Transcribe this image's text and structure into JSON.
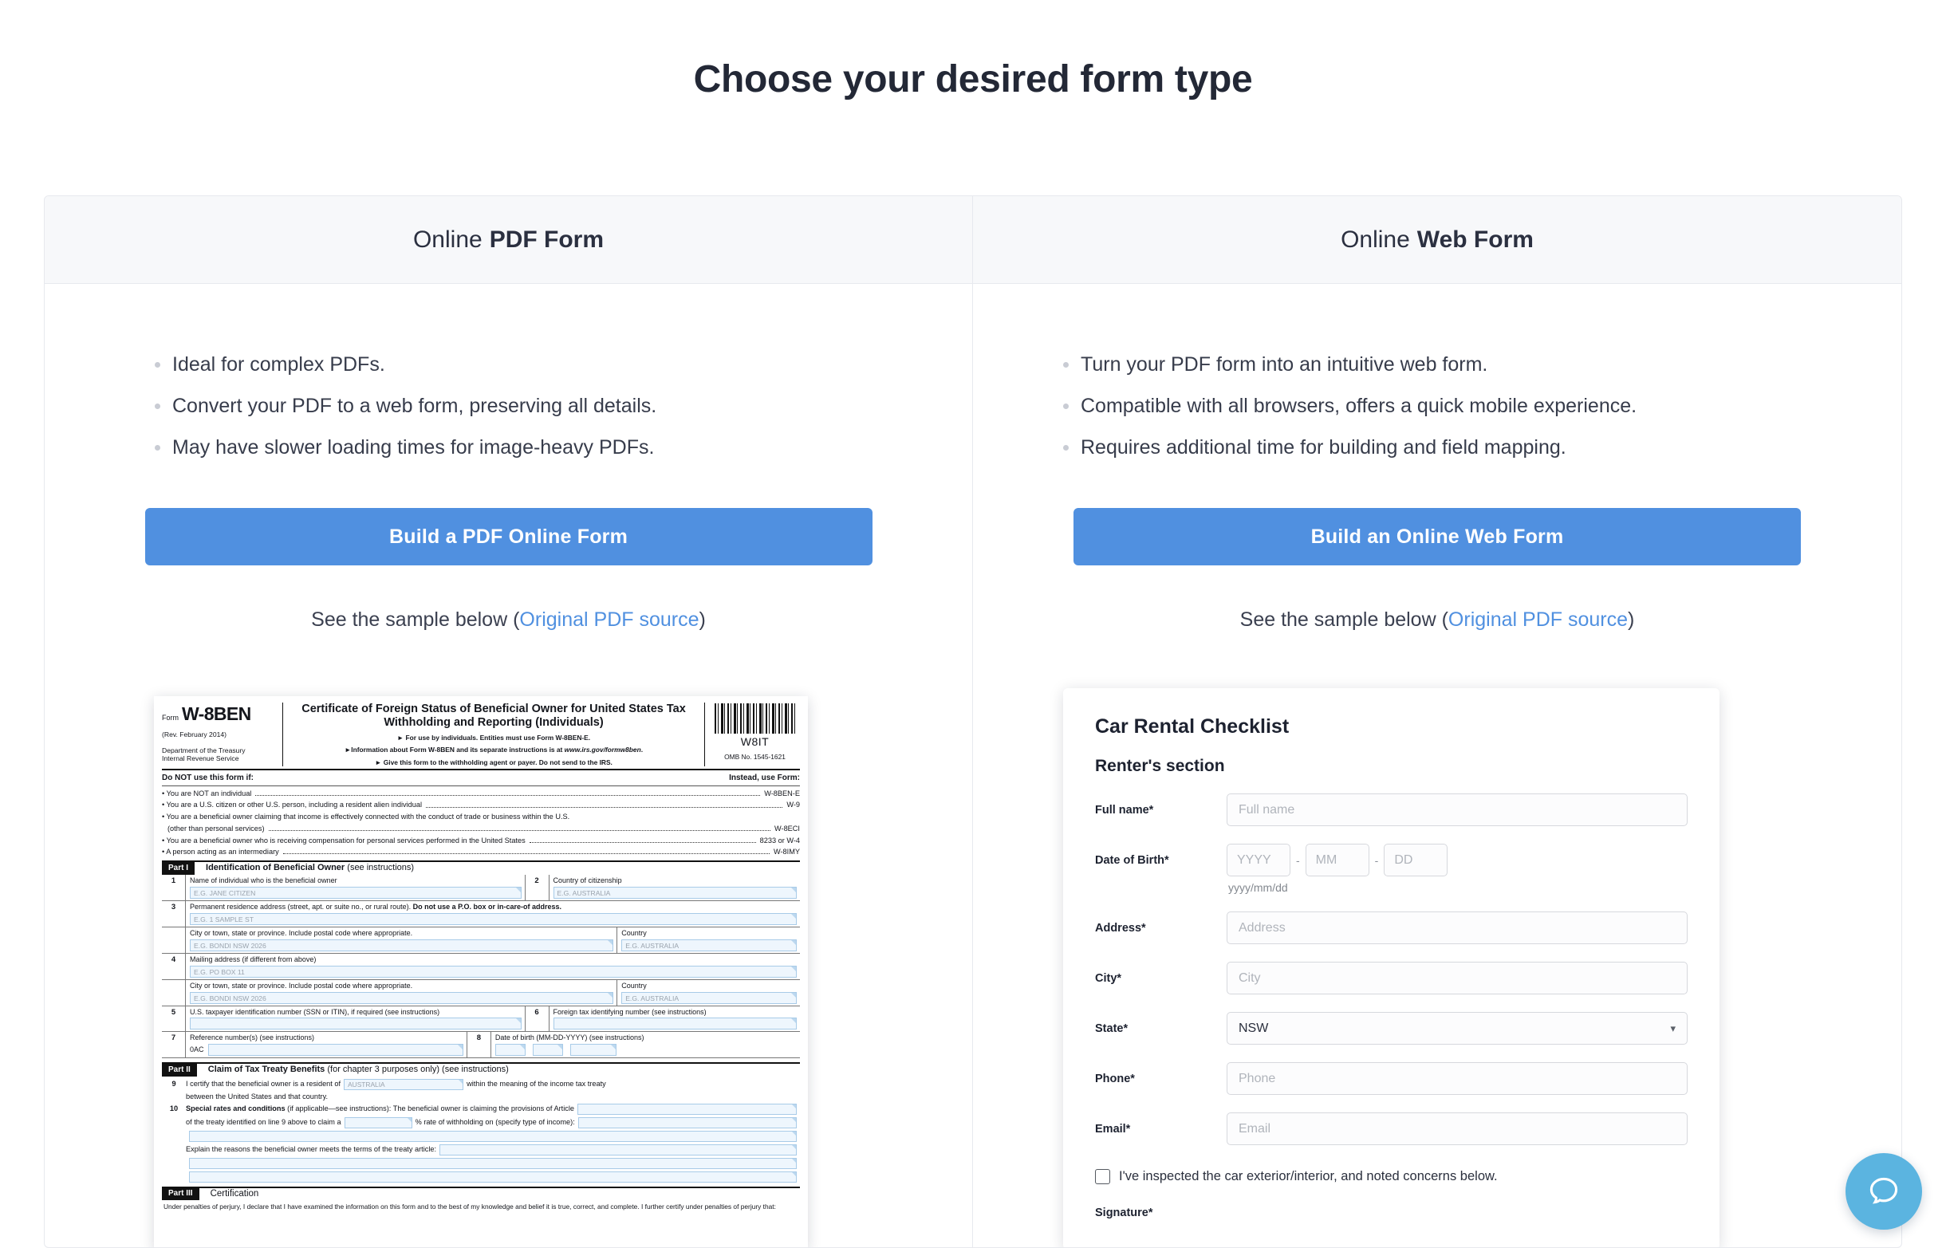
{
  "page": {
    "title": "Choose your desired form type"
  },
  "columns": [
    {
      "head_thin": "Online",
      "head_bold": "PDF Form",
      "bullets": [
        "Ideal for complex PDFs.",
        "Convert your PDF to a web form, preserving all details.",
        "May have slower loading times for image-heavy PDFs."
      ],
      "cta": "Build a PDF Online Form",
      "sample_prefix": "See the sample below (",
      "sample_link": "Original PDF source",
      "sample_suffix": ")"
    },
    {
      "head_thin": "Online",
      "head_bold": "Web Form",
      "bullets": [
        "Turn your PDF form into an intuitive web form.",
        "Compatible with all browsers, offers a quick mobile experience.",
        "Requires additional time for building and field mapping."
      ],
      "cta": "Build an Online Web Form",
      "sample_prefix": "See the sample below (",
      "sample_link": "Original PDF source",
      "sample_suffix": ")"
    }
  ],
  "pdf_preview": {
    "form_word": "Form",
    "form_number": "W-8BEN",
    "revision": "(Rev. February 2014)",
    "department_line1": "Department of the Treasury",
    "department_line2": "Internal Revenue Service",
    "title": "Certificate of Foreign Status of Beneficial Owner for United States Tax Withholding and Reporting (Individuals)",
    "note1": "For use by individuals. Entities must use Form W-8BEN-E.",
    "note2_a": "Information about Form W-8BEN and its separate instructions is at ",
    "note2_b": "www.irs.gov/formw8ben",
    "note2_c": ".",
    "note3": "Give this form to the withholding agent or payer. Do not send to the IRS.",
    "barcode_label": "W8IT",
    "omb": "OMB No. 1545-1621",
    "donot_left": "Do NOT use this form if:",
    "donot_right": "Instead, use Form:",
    "donot_rows": [
      {
        "text": "• You are NOT an individual",
        "result": "W-8BEN-E"
      },
      {
        "text": "• You are a U.S. citizen or other U.S. person, including a resident alien individual",
        "result": "W-9"
      },
      {
        "text": "• You are a beneficial owner claiming that income is effectively connected with the conduct of trade or business within the U.S.",
        "sub": "(other than personal services)",
        "result": "W-8ECI"
      },
      {
        "text": "• You are a beneficial owner who is receiving compensation for personal services performed in the United States",
        "result": "8233 or W-4"
      },
      {
        "text": "• A person acting as an intermediary",
        "result": "W-8IMY"
      }
    ],
    "part1_badge": "Part I",
    "part1_title": "Identification of Beneficial Owner",
    "part1_note": "(see instructions)",
    "line1_num": "1",
    "line1_label": "Name of individual who is the beneficial owner",
    "line1_placeholder": "E.G. JANE CITIZEN",
    "line2_num": "2",
    "line2_label": "Country of citizenship",
    "line2_placeholder": "E.G. AUSTRALIA",
    "line3_num": "3",
    "line3_label_a": "Permanent residence address (street, apt. or suite no., or rural route). ",
    "line3_label_b": "Do not use a P.O. box or in-care-of address.",
    "line3_placeholder": "E.G. 1 SAMPLE ST",
    "city_label": "City or town, state or province. Include postal code where appropriate.",
    "city_placeholder": "E.G. BONDI NSW 2026",
    "country_label": "Country",
    "country_placeholder": "E.G. AUSTRALIA",
    "line4_num": "4",
    "line4_label": "Mailing address (if different from above)",
    "line4_placeholder": "E.G. PO BOX 11",
    "line5_num": "5",
    "line5_label": "U.S. taxpayer identification number (SSN or ITIN), if required (see instructions)",
    "line6_num": "6",
    "line6_label": "Foreign tax identifying number (see instructions)",
    "line7_num": "7",
    "line7_label": "Reference number(s) (see instructions)",
    "line7_prefix": "0AC",
    "line8_num": "8",
    "line8_label": "Date of birth (MM-DD-YYYY) (see instructions)",
    "part2_badge": "Part II",
    "part2_title": "Claim of Tax Treaty Benefits",
    "part2_note": "(for chapter 3 purposes only) (see instructions)",
    "line9_num": "9",
    "line9_a": "I certify that the beneficial owner is a resident of",
    "line9_value": "AUSTRALIA",
    "line9_b": "within the meaning of the income tax treaty",
    "line9_c": "between the United States and that country.",
    "line10_num": "10",
    "line10_bold": "Special rates and conditions",
    "line10_a": "(if applicable—see instructions): The beneficial owner is claiming the provisions of Article",
    "line10_b": "of the treaty identified on line 9 above to claim a",
    "line10_c": "% rate of withholding on (specify type of income):",
    "line10_explain": "Explain the reasons the beneficial owner meets the terms of the treaty article:",
    "part3_badge": "Part III",
    "part3_title": "Certification",
    "part3_text": "Under penalties of perjury, I declare that I have examined the information on this form and to the best of my knowledge and belief it is true, correct, and complete. I further certify under penalties of perjury that:"
  },
  "web_preview": {
    "title": "Car Rental Checklist",
    "subtitle": "Renter's section",
    "fields": [
      {
        "label": "Full name*",
        "placeholder": "Full name"
      },
      {
        "label": "Address*",
        "placeholder": "Address"
      },
      {
        "label": "City*",
        "placeholder": "City"
      },
      {
        "label": "Phone*",
        "placeholder": "Phone"
      },
      {
        "label": "Email*",
        "placeholder": "Email"
      }
    ],
    "dob_label": "Date of Birth*",
    "dob_year": "YYYY",
    "dob_month": "MM",
    "dob_day": "DD",
    "dob_sep": "-",
    "dob_hint": "yyyy/mm/dd",
    "state_label": "State*",
    "state_value": "NSW",
    "checkbox_label": "I've inspected the car exterior/interior, and noted concerns below.",
    "signature_label": "Signature*"
  },
  "chat": {
    "name": "chat-bubble"
  },
  "colors": {
    "accent": "#5090e0",
    "chat": "#5bb4e0",
    "title": "#232836"
  }
}
